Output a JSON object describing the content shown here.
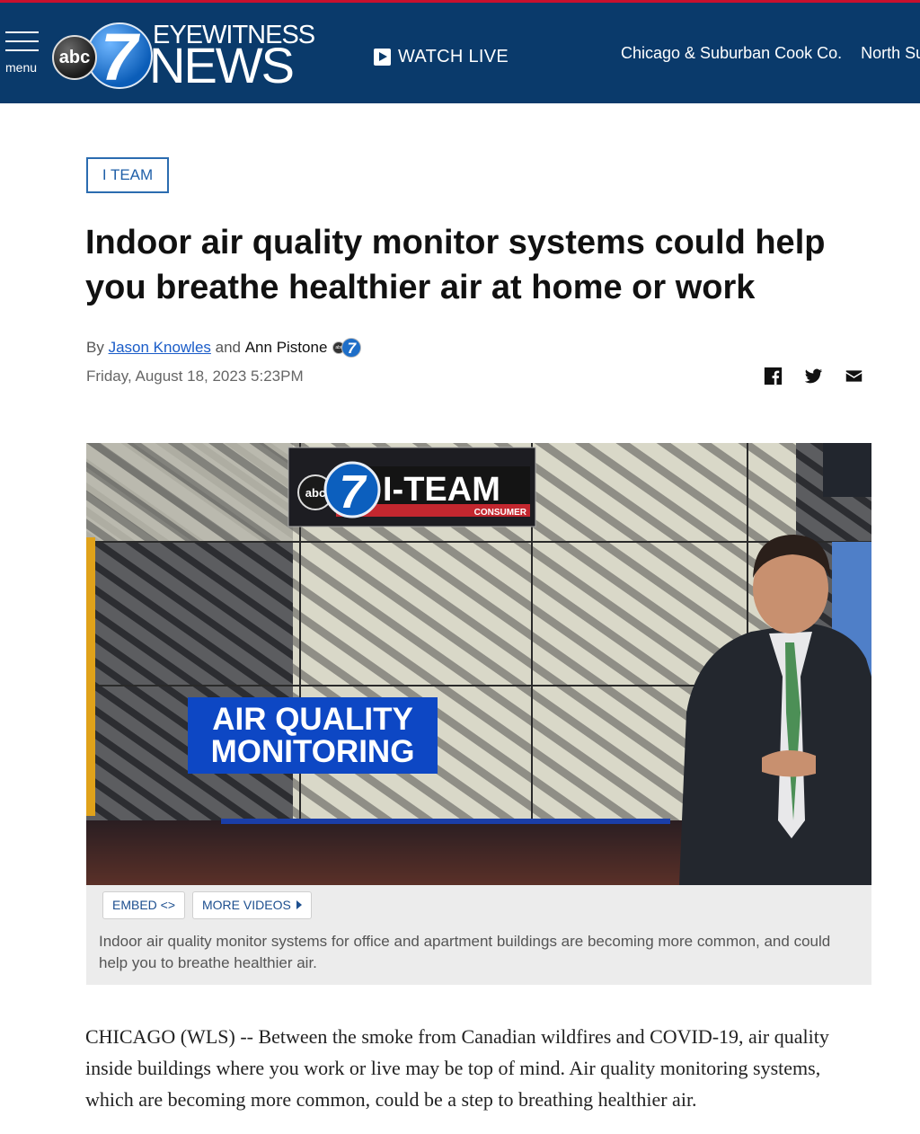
{
  "header": {
    "menu_label": "menu",
    "logo": {
      "ball_abc": "abc",
      "ball_seven": "7",
      "eyewitness": "EYEWITNESS",
      "news": "NEWS"
    },
    "watch_live_label": "WATCH LIVE",
    "nav_links": [
      "Chicago & Suburban Cook Co.",
      "North Sub"
    ]
  },
  "article": {
    "category": "I TEAM",
    "headline": "Indoor air quality monitor systems could help you breathe healthier air at home or work",
    "byline": {
      "by": "By ",
      "author1": "Jason Knowles",
      "and": " and ",
      "author2": "Ann Pistone",
      "badge": {
        "abc": "abc",
        "seven": "7"
      }
    },
    "date": "Friday, August 18, 2023 5:23PM",
    "share_icons": [
      "facebook-icon",
      "twitter-icon",
      "email-icon"
    ]
  },
  "video": {
    "graphic_iteam": "I-TEAM",
    "graphic_consumer": "CONSUMER",
    "graphic_abc": "abc",
    "graphic_seven": "7",
    "graphic_title_line1": "AIR QUALITY",
    "graphic_title_line2": "MONITORING",
    "embed_label": "EMBED <>",
    "more_videos_label": "MORE VIDEOS",
    "caption": "Indoor air quality monitor systems for office and apartment buildings are becoming more common, and could help you to breathe healthier air."
  },
  "body": {
    "paragraph1": "CHICAGO (WLS) -- Between the smoke from Canadian wildfires and COVID-19, air quality inside buildings where you work or live may be top of mind. Air quality monitoring systems, which are becoming more common, could be a step to breathing healthier air."
  },
  "colors": {
    "header_bg": "#0a3a6b",
    "header_top_stripe": "#c8102e",
    "link_blue": "#1a5cc8",
    "tag_blue": "#2b6cb0"
  }
}
